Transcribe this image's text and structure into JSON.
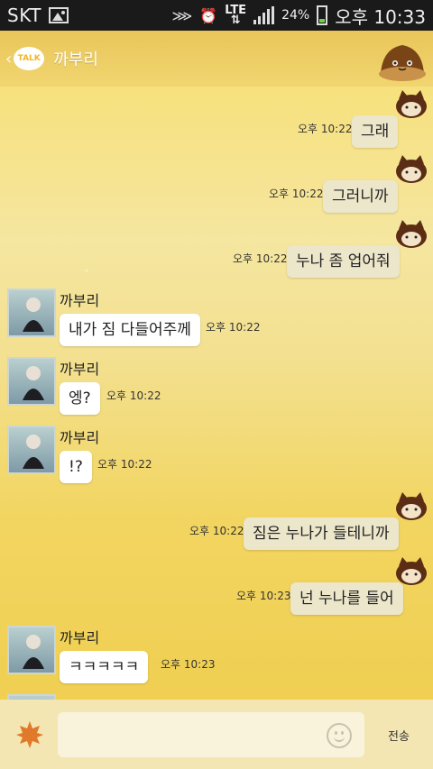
{
  "status_bar": {
    "carrier": "SKT",
    "network": "LTE",
    "battery": "24%",
    "clock": "오후 10:33"
  },
  "header": {
    "badge": "TALK",
    "title": "까부리"
  },
  "messages": [
    {
      "side": "sent",
      "text": "그래",
      "time": "오후 10:22"
    },
    {
      "side": "sent",
      "text": "그러니까",
      "time": "오후 10:22"
    },
    {
      "side": "sent",
      "text": "누나 좀 업어줘",
      "time": "오후 10:22"
    },
    {
      "side": "received",
      "name": "까부리",
      "text": "내가 짐 다들어주께",
      "time": "오후 10:22"
    },
    {
      "side": "received",
      "name": "까부리",
      "text": "엥?",
      "time": "오후 10:22"
    },
    {
      "side": "received",
      "name": "까부리",
      "text": "!?",
      "time": "오후 10:22"
    },
    {
      "side": "sent",
      "text": "짐은 누나가 들테니까",
      "time": "오후 10:22"
    },
    {
      "side": "sent",
      "text": "넌 누나를 들어",
      "time": "오후 10:23"
    },
    {
      "side": "received",
      "name": "까부리",
      "text": "ㅋㅋㅋㅋㅋ",
      "time": "오후 10:23"
    }
  ],
  "input": {
    "placeholder": "",
    "send_label": "전송"
  },
  "colors": {
    "sent_bubble": "#ece6ca",
    "received_bubble": "#ffffff",
    "background": "#f6dc72"
  }
}
